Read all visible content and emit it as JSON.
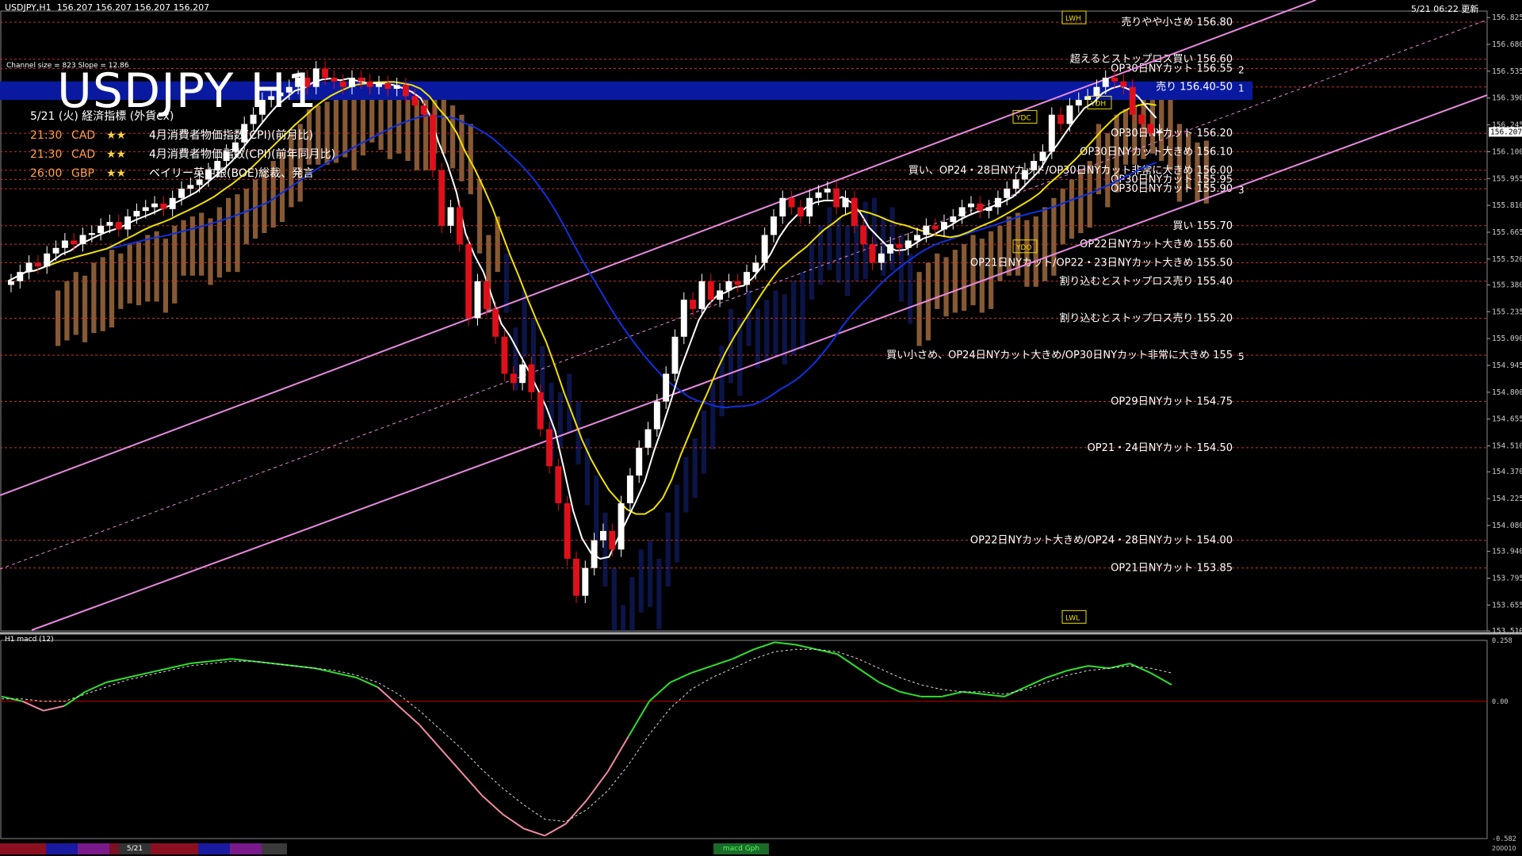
{
  "window": {
    "symbol_header": "USDJPY,H1",
    "ohlc_header": "156.207 156.207 156.207 156.207",
    "updated": "5/21 06:22 更新",
    "channel_info": "Channel size = 823 Slope = 12.86",
    "subwindow_label": "H1  macd (12)",
    "bottom_tab_date": "5/21",
    "bottom_tab_macd": "macd Gph",
    "bottom_right": "200010"
  },
  "title": "USDJPY H1",
  "econ": {
    "heading": "5/21 (火) 経済指標 (外貨ex)",
    "items": [
      {
        "time": "21:30",
        "ccy": "CAD",
        "stars": "★★",
        "text": "4月消費者物価指数(CPI)(前月比)"
      },
      {
        "time": "21:30",
        "ccy": "CAD",
        "stars": "★★",
        "text": "4月消費者物価指数(CPI)(前年同月比)"
      },
      {
        "time": "26:00",
        "ccy": "GBP",
        "stars": "★★",
        "text": "ベイリー英中銀(BOE)総裁、発言"
      }
    ]
  },
  "colors": {
    "bull": "#ffffff",
    "bear": "#e0101a",
    "channel": "#e88ae0",
    "ma_fast": "#ffffff",
    "ma_mid": "#f0e000",
    "ma_slow": "#1030e0",
    "cloud_up": "#f4a460",
    "cloud_down": "#1a2f9e",
    "sell_zone": "#0a1aa0",
    "macd_pos": "#2ee02e",
    "macd_neg": "#f08aa0",
    "level_line": "#c83030"
  },
  "chart_data": {
    "type": "candlestick",
    "symbol": "USDJPY",
    "timeframe": "H1",
    "ylim": [
      153.51,
      156.86
    ],
    "y_ticks": [
      156.825,
      156.68,
      156.535,
      156.39,
      156.245,
      156.1,
      155.955,
      155.81,
      155.665,
      155.52,
      155.38,
      155.235,
      155.09,
      154.945,
      154.8,
      154.655,
      154.51,
      154.37,
      154.225,
      154.08,
      153.94,
      153.795,
      153.65,
      153.51
    ],
    "y_tick_labels": [
      "156.825",
      "156.680",
      "156.535",
      "156.390",
      "156.245",
      "156.100",
      "155.955",
      "155.810",
      "155.665",
      "155.520",
      "155.380",
      "155.235",
      "155.090",
      "154.945",
      "154.800",
      "154.655",
      "154.510",
      "154.370",
      "154.225",
      "154.080",
      "153.940",
      "153.795",
      "153.655",
      "153.510"
    ],
    "current_price": "156.207",
    "candles_close": [
      155.4,
      155.45,
      155.5,
      155.48,
      155.55,
      155.58,
      155.62,
      155.6,
      155.65,
      155.66,
      155.7,
      155.72,
      155.68,
      155.75,
      155.78,
      155.8,
      155.82,
      155.79,
      155.85,
      155.9,
      155.92,
      155.95,
      156.0,
      156.05,
      156.1,
      156.15,
      156.25,
      156.3,
      156.38,
      156.4,
      156.42,
      156.45,
      156.5,
      156.45,
      156.55,
      156.5,
      156.48,
      156.45,
      156.5,
      156.48,
      156.45,
      156.47,
      156.44,
      156.46,
      156.4,
      156.35,
      156.3,
      156.0,
      155.7,
      155.8,
      155.6,
      155.2,
      155.4,
      155.25,
      155.1,
      154.9,
      154.85,
      154.95,
      154.8,
      154.6,
      154.4,
      154.2,
      153.9,
      153.7,
      153.85,
      154.0,
      154.05,
      153.95,
      154.2,
      154.35,
      154.5,
      154.6,
      154.75,
      154.9,
      155.1,
      155.3,
      155.25,
      155.4,
      155.3,
      155.35,
      155.4,
      155.38,
      155.45,
      155.5,
      155.65,
      155.75,
      155.85,
      155.8,
      155.75,
      155.85,
      155.88,
      155.9,
      155.8,
      155.85,
      155.7,
      155.6,
      155.5,
      155.55,
      155.6,
      155.58,
      155.62,
      155.65,
      155.7,
      155.68,
      155.72,
      155.75,
      155.8,
      155.82,
      155.78,
      155.8,
      155.85,
      155.9,
      155.95,
      156.0,
      156.05,
      156.1,
      156.3,
      156.25,
      156.35,
      156.38,
      156.4,
      156.45,
      156.5,
      156.48,
      156.45,
      156.3,
      156.25,
      156.2,
      156.21
    ],
    "levels": [
      {
        "price": 156.8,
        "label": "売りやや小さめ 156.80"
      },
      {
        "price": 156.6,
        "label": "超えるとストップロス買い 156.60"
      },
      {
        "price": 156.55,
        "label": "OP30日NYカット 156.55",
        "tag": "2"
      },
      {
        "price": 156.45,
        "label": "売り 156.40-50",
        "tag": "1"
      },
      {
        "price": 156.2,
        "label": "OP30日NYカット 156.20"
      },
      {
        "price": 156.1,
        "label": "OP30日NYカット大きめ 156.10"
      },
      {
        "price": 156.0,
        "label": "買い、OP24・28日NYカット/OP30日NYカット非常に大きめ 156.00"
      },
      {
        "price": 155.95,
        "label": "OP30日NYカット 155.95"
      },
      {
        "price": 155.9,
        "label": "OP30日NYカット 155.90",
        "tag": "3"
      },
      {
        "price": 155.7,
        "label": "買い 155.70"
      },
      {
        "price": 155.6,
        "label": "OP22日NYカット大きめ 155.60"
      },
      {
        "price": 155.5,
        "label": "OP21日NYカット/OP22・23日NYカット大きめ 155.50"
      },
      {
        "price": 155.4,
        "label": "割り込むとストップロス売り 155.40"
      },
      {
        "price": 155.2,
        "label": "割り込むとストップロス売り 155.20"
      },
      {
        "price": 155.0,
        "label": "買い小さめ、OP24日NYカット大きめ/OP30日NYカット非常に大きめ 155",
        "tag": "5"
      },
      {
        "price": 154.75,
        "label": "OP29日NYカット 154.75"
      },
      {
        "price": 154.5,
        "label": "OP21・24日NYカット 154.50"
      },
      {
        "price": 154.0,
        "label": "OP22日NYカット大きめ/OP24・28日NYカット 154.00"
      },
      {
        "price": 153.85,
        "label": "OP21日NYカット 153.85"
      }
    ],
    "markers": [
      "LWH",
      "YDC",
      "YDH",
      "YDO",
      "LWL"
    ],
    "macd": {
      "ylim": [
        -0.582,
        0.258
      ],
      "y_tick_labels": [
        "0.258",
        "0.00",
        "-0.582"
      ],
      "main": [
        0.02,
        0.0,
        -0.04,
        -0.02,
        0.04,
        0.08,
        0.1,
        0.12,
        0.14,
        0.16,
        0.17,
        0.18,
        0.17,
        0.16,
        0.15,
        0.14,
        0.12,
        0.1,
        0.06,
        -0.02,
        -0.1,
        -0.2,
        -0.3,
        -0.4,
        -0.48,
        -0.54,
        -0.57,
        -0.52,
        -0.42,
        -0.3,
        -0.15,
        0.0,
        0.08,
        0.12,
        0.15,
        0.18,
        0.22,
        0.25,
        0.24,
        0.22,
        0.2,
        0.14,
        0.08,
        0.04,
        0.02,
        0.02,
        0.04,
        0.03,
        0.02,
        0.06,
        0.1,
        0.13,
        0.15,
        0.14,
        0.16,
        0.12,
        0.07
      ],
      "signal": [
        0.01,
        0.01,
        0.0,
        0.0,
        0.03,
        0.06,
        0.09,
        0.11,
        0.13,
        0.15,
        0.16,
        0.17,
        0.17,
        0.16,
        0.15,
        0.14,
        0.13,
        0.11,
        0.08,
        0.03,
        -0.04,
        -0.12,
        -0.2,
        -0.29,
        -0.37,
        -0.44,
        -0.5,
        -0.51,
        -0.46,
        -0.38,
        -0.27,
        -0.14,
        -0.03,
        0.05,
        0.1,
        0.14,
        0.18,
        0.21,
        0.22,
        0.22,
        0.21,
        0.18,
        0.14,
        0.1,
        0.07,
        0.05,
        0.04,
        0.04,
        0.03,
        0.05,
        0.08,
        0.11,
        0.13,
        0.14,
        0.15,
        0.14,
        0.12
      ]
    }
  }
}
